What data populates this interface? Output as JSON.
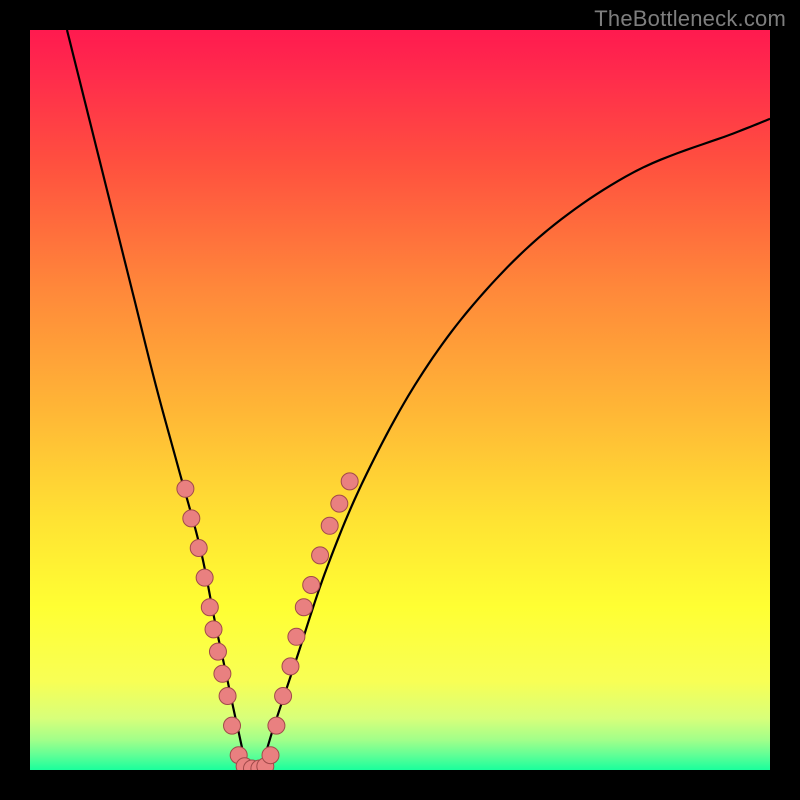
{
  "watermark": "TheBottleneck.com",
  "colors": {
    "frame": "#000000",
    "gradient_stops": [
      {
        "pct": 0,
        "color": "#ff1a4f"
      },
      {
        "pct": 6,
        "color": "#ff2b4c"
      },
      {
        "pct": 18,
        "color": "#ff503f"
      },
      {
        "pct": 35,
        "color": "#ff883a"
      },
      {
        "pct": 52,
        "color": "#ffb836"
      },
      {
        "pct": 66,
        "color": "#ffe233"
      },
      {
        "pct": 78,
        "color": "#ffff33"
      },
      {
        "pct": 88,
        "color": "#f8ff55"
      },
      {
        "pct": 93,
        "color": "#d8ff7a"
      },
      {
        "pct": 96,
        "color": "#a0ff8a"
      },
      {
        "pct": 98,
        "color": "#60ff96"
      },
      {
        "pct": 100,
        "color": "#1aff9c"
      }
    ],
    "curve": "#000000",
    "dot_fill": "#e98080",
    "dot_stroke": "#a14a4a"
  },
  "chart_data": {
    "type": "line",
    "title": "",
    "xlabel": "",
    "ylabel": "",
    "xlim": [
      0,
      100
    ],
    "ylim": [
      0,
      100
    ],
    "series": [
      {
        "name": "bottleneck-curve",
        "x": [
          5,
          8,
          11,
          14,
          17,
          20,
          23,
          25,
          26.5,
          28,
          29.5,
          31,
          33,
          36,
          40,
          45,
          52,
          60,
          70,
          82,
          95,
          100
        ],
        "y": [
          100,
          88,
          76,
          64,
          52,
          41,
          30,
          20,
          13,
          6,
          0,
          0,
          6,
          15,
          27,
          39,
          52,
          63,
          73,
          81,
          86,
          88
        ]
      }
    ],
    "scatter_points": {
      "name": "dots",
      "points": [
        {
          "x": 21.0,
          "y": 38
        },
        {
          "x": 21.8,
          "y": 34
        },
        {
          "x": 22.8,
          "y": 30
        },
        {
          "x": 23.6,
          "y": 26
        },
        {
          "x": 24.3,
          "y": 22
        },
        {
          "x": 24.8,
          "y": 19
        },
        {
          "x": 25.4,
          "y": 16
        },
        {
          "x": 26.0,
          "y": 13
        },
        {
          "x": 26.7,
          "y": 10
        },
        {
          "x": 27.3,
          "y": 6
        },
        {
          "x": 28.2,
          "y": 2
        },
        {
          "x": 29.0,
          "y": 0.5
        },
        {
          "x": 30.0,
          "y": 0.2
        },
        {
          "x": 31.0,
          "y": 0.2
        },
        {
          "x": 31.8,
          "y": 0.5
        },
        {
          "x": 32.5,
          "y": 2
        },
        {
          "x": 33.3,
          "y": 6
        },
        {
          "x": 34.2,
          "y": 10
        },
        {
          "x": 35.2,
          "y": 14
        },
        {
          "x": 36.0,
          "y": 18
        },
        {
          "x": 37.0,
          "y": 22
        },
        {
          "x": 38.0,
          "y": 25
        },
        {
          "x": 39.2,
          "y": 29
        },
        {
          "x": 40.5,
          "y": 33
        },
        {
          "x": 41.8,
          "y": 36
        },
        {
          "x": 43.2,
          "y": 39
        }
      ]
    }
  }
}
